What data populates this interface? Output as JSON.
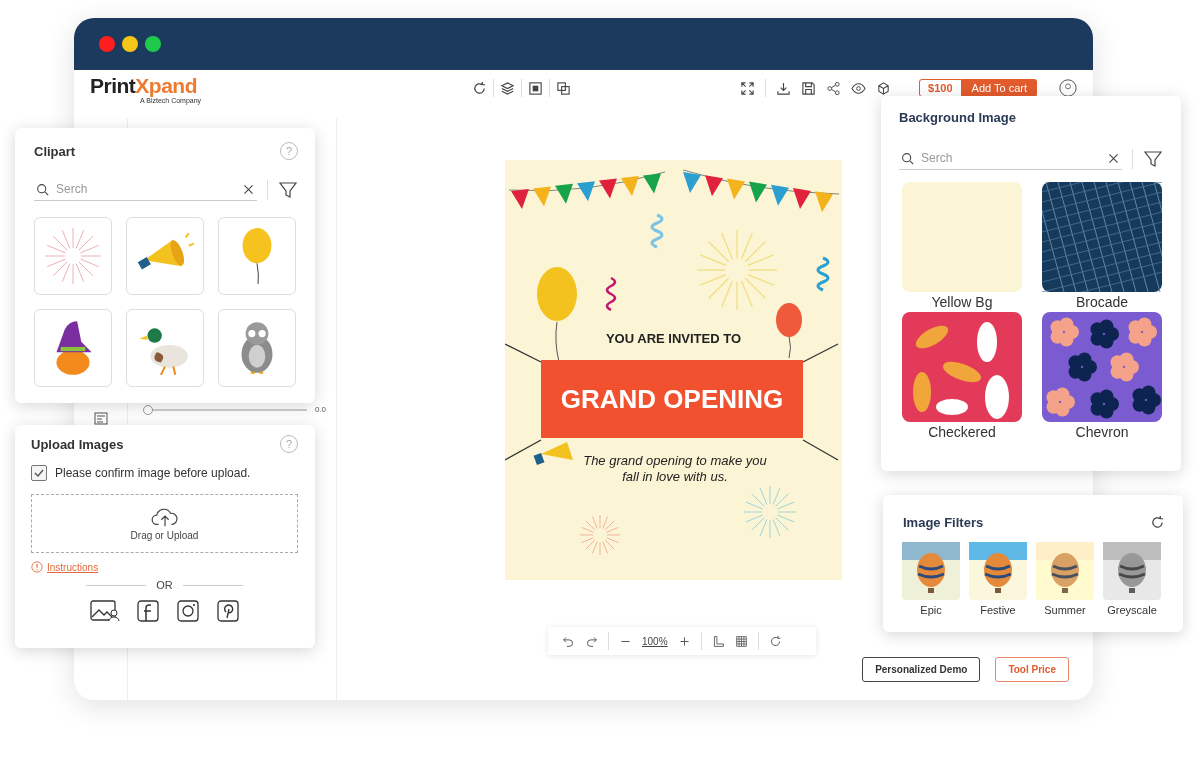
{
  "window": {
    "controls": [
      {
        "color": "#ff1e1e"
      },
      {
        "color": "#f5c518"
      },
      {
        "color": "#1ec94c"
      }
    ]
  },
  "header": {
    "logo": {
      "part_a": "Print",
      "part_b": "Xpand",
      "tagline": "A Biztech Company"
    },
    "price": "$100",
    "cart": "Add To cart"
  },
  "side_panel": {
    "slider": {
      "level": 0,
      "reading": "0.0"
    }
  },
  "poster": {
    "kicker": "YOU ARE INVITED TO",
    "headline": "GRAND OPENING",
    "tagline": "The grand opening to make you fall in love with us."
  },
  "zoom_toolbar": {
    "zoom": "100%"
  },
  "buttons": [
    {
      "label": "Personalized Demo",
      "kind": "outline"
    },
    {
      "label": "Tool Price",
      "kind": "accent"
    }
  ],
  "clipart": {
    "title": "Clipart",
    "help": "?",
    "search": {
      "placeholder": "Serch"
    },
    "items": [
      {
        "kind": "burst"
      },
      {
        "kind": "megaphone"
      },
      {
        "kind": "balloon"
      },
      {
        "kind": "pumpkin"
      },
      {
        "kind": "duck"
      },
      {
        "kind": "owl"
      }
    ]
  },
  "upload": {
    "title": "Upload Images",
    "help": "?",
    "confirm": {
      "label": "Please confirm image before upload.",
      "checked": true
    },
    "dropzone": "Drag or Upload",
    "instructions": "Instructions",
    "or": "OR"
  },
  "background_image": {
    "title": "Background Image",
    "search": {
      "placeholder": "Serch"
    },
    "items": [
      {
        "label": "Yellow Bg",
        "kind": "plain"
      },
      {
        "label": "Brocade",
        "kind": "brocade"
      },
      {
        "label": "Checkered",
        "kind": "leaves"
      },
      {
        "label": "Chevron",
        "kind": "flowers"
      }
    ]
  },
  "image_filters": {
    "title": "Image Filters",
    "items": [
      {
        "label": "Epic",
        "kind": "epic"
      },
      {
        "label": "Festive",
        "kind": "festive"
      },
      {
        "label": "Summer",
        "kind": "summer"
      },
      {
        "label": "Greyscale",
        "kind": "greyscale"
      }
    ]
  }
}
